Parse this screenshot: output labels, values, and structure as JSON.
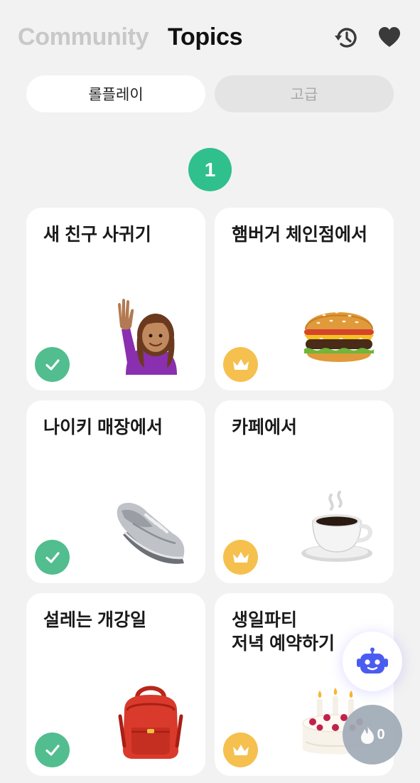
{
  "header": {
    "tab_community": "Community",
    "tab_topics": "Topics",
    "history_icon": "history-icon",
    "favorites_icon": "heart-icon"
  },
  "segments": {
    "roleplay": "롤플레이",
    "advanced": "고급"
  },
  "level": {
    "number": "1"
  },
  "cards": [
    {
      "title": "새 친구 사귀기",
      "icon": "person-raising-hand",
      "status": "completed"
    },
    {
      "title": "햄버거 체인점에서",
      "icon": "hamburger",
      "status": "locked-premium"
    },
    {
      "title": "나이키 매장에서",
      "icon": "sneaker",
      "status": "completed"
    },
    {
      "title": "카페에서",
      "icon": "hot-coffee",
      "status": "locked-premium"
    },
    {
      "title": "설레는 개강일",
      "icon": "backpack",
      "status": "completed"
    },
    {
      "title": "생일파티\n저녁 예약하기",
      "icon": "birthday-cake",
      "status": "locked-premium"
    }
  ],
  "fab": {
    "bot_icon": "robot-icon",
    "streak_icon": "fire-icon",
    "streak_count": "0"
  },
  "colors": {
    "accent_green": "#2fc08e",
    "check_green": "#52bd8e",
    "crown_yellow": "#f5c04e",
    "background": "#f2f2f2",
    "bot_blue": "#4a5cf0"
  }
}
